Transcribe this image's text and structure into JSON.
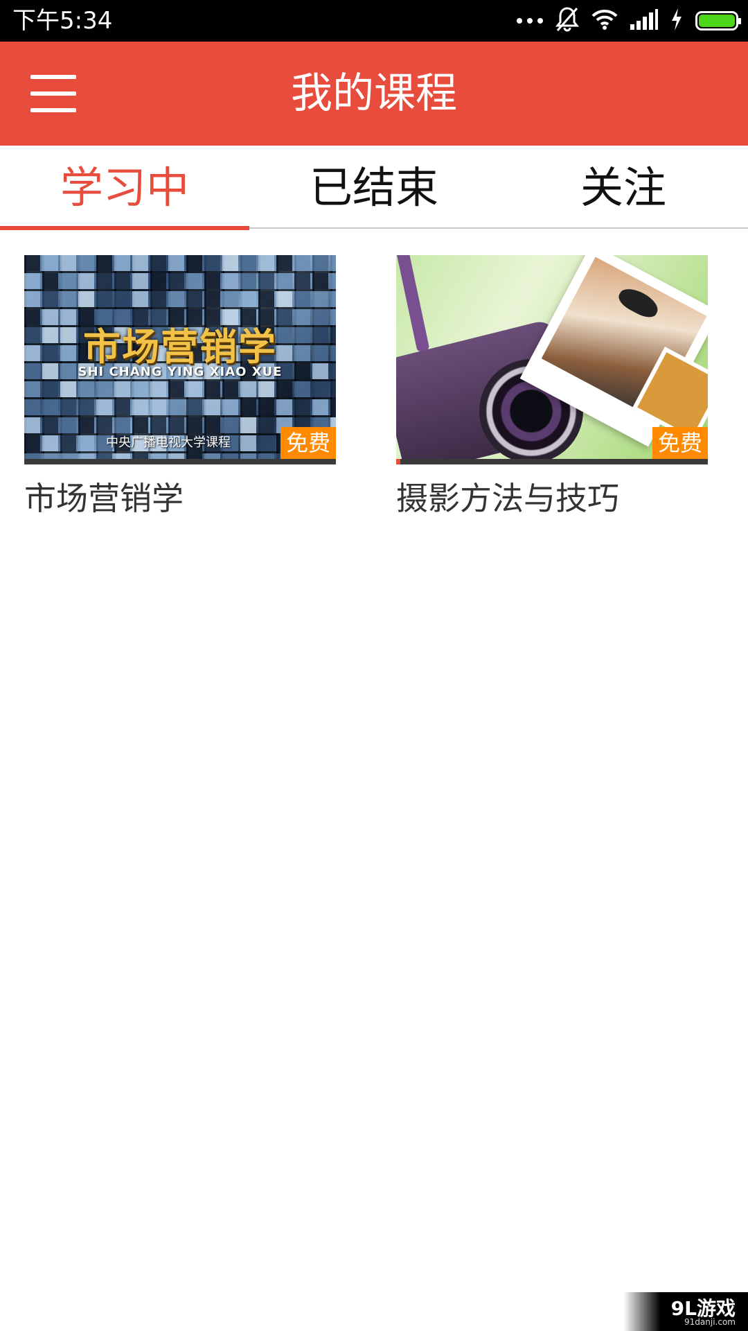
{
  "status_bar": {
    "time": "下午5:34",
    "icons": [
      "more-dots-icon",
      "bell-muted-icon",
      "wifi-icon",
      "signal-icon",
      "charging-icon",
      "battery-icon"
    ],
    "battery_color": "#4cd51b"
  },
  "app_bar": {
    "title": "我的课程",
    "menu_icon": "hamburger-menu-icon",
    "color": "#e84c3d"
  },
  "tabs": [
    {
      "label": "学习中",
      "active": true
    },
    {
      "label": "已结束",
      "active": false
    },
    {
      "label": "关注",
      "active": false
    }
  ],
  "courses": [
    {
      "title": "市场营销学",
      "badge": "免费",
      "thumbnail": {
        "headline": "市场营销学",
        "subtitle": "SHI CHANG YING XIAO XUE",
        "org": "中央广播电视大学课程"
      }
    },
    {
      "title": "摄影方法与技巧",
      "badge": "免费",
      "thumbnail": {}
    }
  ],
  "watermark": {
    "logo": "9L游戏",
    "url": "91danji.com"
  },
  "colors": {
    "accent": "#e84c3d",
    "badge": "#ff8a00"
  }
}
